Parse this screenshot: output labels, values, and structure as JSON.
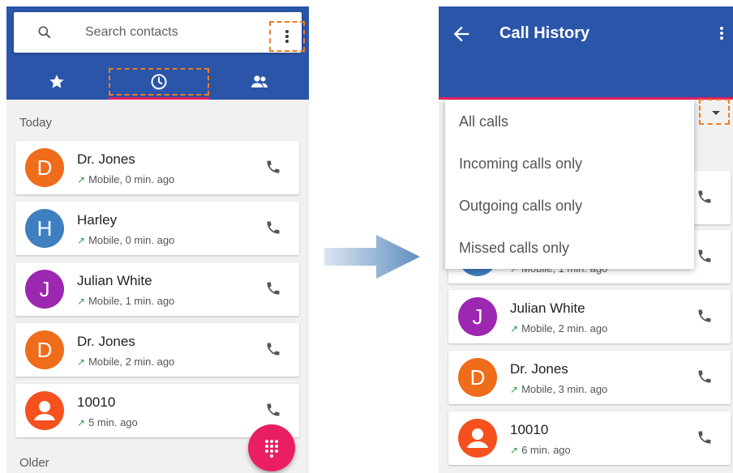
{
  "left": {
    "search_placeholder": "Search contacts",
    "today_label": "Today",
    "older_label": "Older",
    "contacts": [
      {
        "initial": "D",
        "name": "Dr. Jones",
        "sub": "Mobile, 0 min. ago",
        "color": "#ef6c1a"
      },
      {
        "initial": "H",
        "name": "Harley",
        "sub": "Mobile, 0 min. ago",
        "color": "#3f7fbf"
      },
      {
        "initial": "J",
        "name": "Julian White",
        "sub": "Mobile, 1 min. ago",
        "color": "#9c27b0"
      },
      {
        "initial": "D",
        "name": "Dr. Jones",
        "sub": "Mobile, 2 min. ago",
        "color": "#ef6c1a"
      },
      {
        "initial": "",
        "name": "10010",
        "sub": "5 min. ago",
        "color": "#f4511e"
      }
    ]
  },
  "right": {
    "title": "Call History",
    "menu": [
      "All calls",
      "Incoming calls only",
      "Outgoing calls only",
      "Missed calls only"
    ],
    "partial_sub": "Mobile, 1 min. ago",
    "contacts": [
      {
        "initial": "J",
        "name": "Julian White",
        "sub": "Mobile, 2 min. ago",
        "color": "#9c27b0"
      },
      {
        "initial": "D",
        "name": "Dr. Jones",
        "sub": "Mobile, 3 min. ago",
        "color": "#ef6c1a"
      },
      {
        "initial": "",
        "name": "10010",
        "sub": "6 min. ago",
        "color": "#f4511e"
      }
    ]
  },
  "colors": {
    "primary": "#2a55a9",
    "accent": "#e91e63",
    "highlight": "#f07d1e"
  },
  "icons": {
    "search": "search-icon",
    "more": "more-vert-icon",
    "favorites": "star-icon",
    "recents": "clock-icon",
    "contacts": "people-icon",
    "call": "phone-icon",
    "back": "arrow-back-icon",
    "dialpad": "dialpad-icon",
    "filter": "dropdown-caret-icon"
  }
}
